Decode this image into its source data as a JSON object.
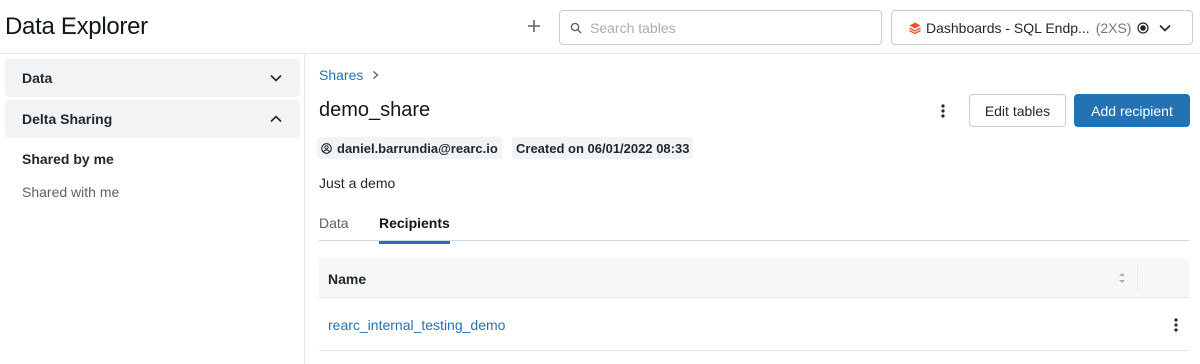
{
  "header": {
    "title": "Data Explorer",
    "search_placeholder": "Search tables",
    "endpoint": {
      "name": "Dashboards - SQL Endp...",
      "size": "(2XS)",
      "icon": "sql-warehouse-icon",
      "status_icon": "status-dot-icon"
    }
  },
  "sidebar": {
    "groups": [
      {
        "label": "Data",
        "expanded": false
      },
      {
        "label": "Delta Sharing",
        "expanded": true
      }
    ],
    "items": [
      {
        "label": "Shared by me",
        "active": true
      },
      {
        "label": "Shared with me",
        "active": false
      }
    ]
  },
  "main": {
    "breadcrumb": "Shares",
    "title": "demo_share",
    "owner": "daniel.barrundia@rearc.io",
    "created": "Created on 06/01/2022 08:33",
    "description": "Just a demo",
    "buttons": {
      "edit": "Edit tables",
      "add": "Add recipient"
    },
    "tabs": [
      {
        "label": "Data",
        "active": false
      },
      {
        "label": "Recipients",
        "active": true
      }
    ],
    "table": {
      "columns": [
        "Name"
      ],
      "rows": [
        {
          "name": "rearc_internal_testing_demo"
        }
      ]
    }
  },
  "colors": {
    "accent": "#2272b4",
    "warehouse_icon": "#e8572b",
    "sidebar_bg": "#f2f3f5"
  }
}
